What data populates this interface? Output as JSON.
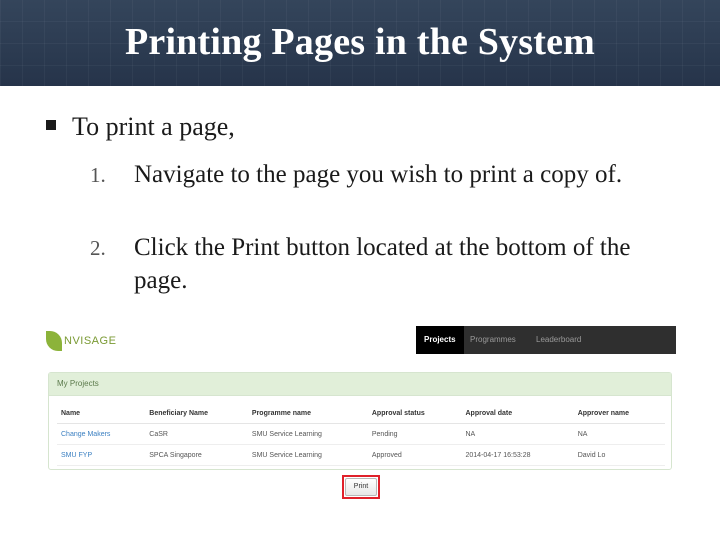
{
  "slide": {
    "title": "Printing Pages in the System",
    "bullet": "To print a page,",
    "steps": [
      {
        "num": "1.",
        "text": "Navigate to the page you wish to print a copy of."
      },
      {
        "num": "2.",
        "text": "Click the Print button located at the bottom of the page."
      }
    ]
  },
  "app": {
    "logo_text": "NVISAGE",
    "nav": [
      {
        "label": "Projects",
        "active": true
      },
      {
        "label": "Programmes",
        "active": false
      },
      {
        "label": "Leaderboard",
        "active": false
      }
    ],
    "panel_title": "My Projects",
    "table": {
      "headers": [
        "Name",
        "Beneficiary Name",
        "Programme name",
        "Approval status",
        "Approval date",
        "Approver name"
      ],
      "rows": [
        [
          "Change Makers",
          "CaSR",
          "SMU Service Learning",
          "Pending",
          "NA",
          "NA"
        ],
        [
          "SMU FYP",
          "SPCA Singapore",
          "SMU Service Learning",
          "Approved",
          "2014-04-17 16:53:28",
          "David Lo"
        ]
      ]
    },
    "print_label": "Print"
  },
  "colors": {
    "title_bar": "#2b3a4d",
    "panel_header": "#e1efd9",
    "link": "#3a7fc1",
    "highlight": "#e0202a"
  }
}
